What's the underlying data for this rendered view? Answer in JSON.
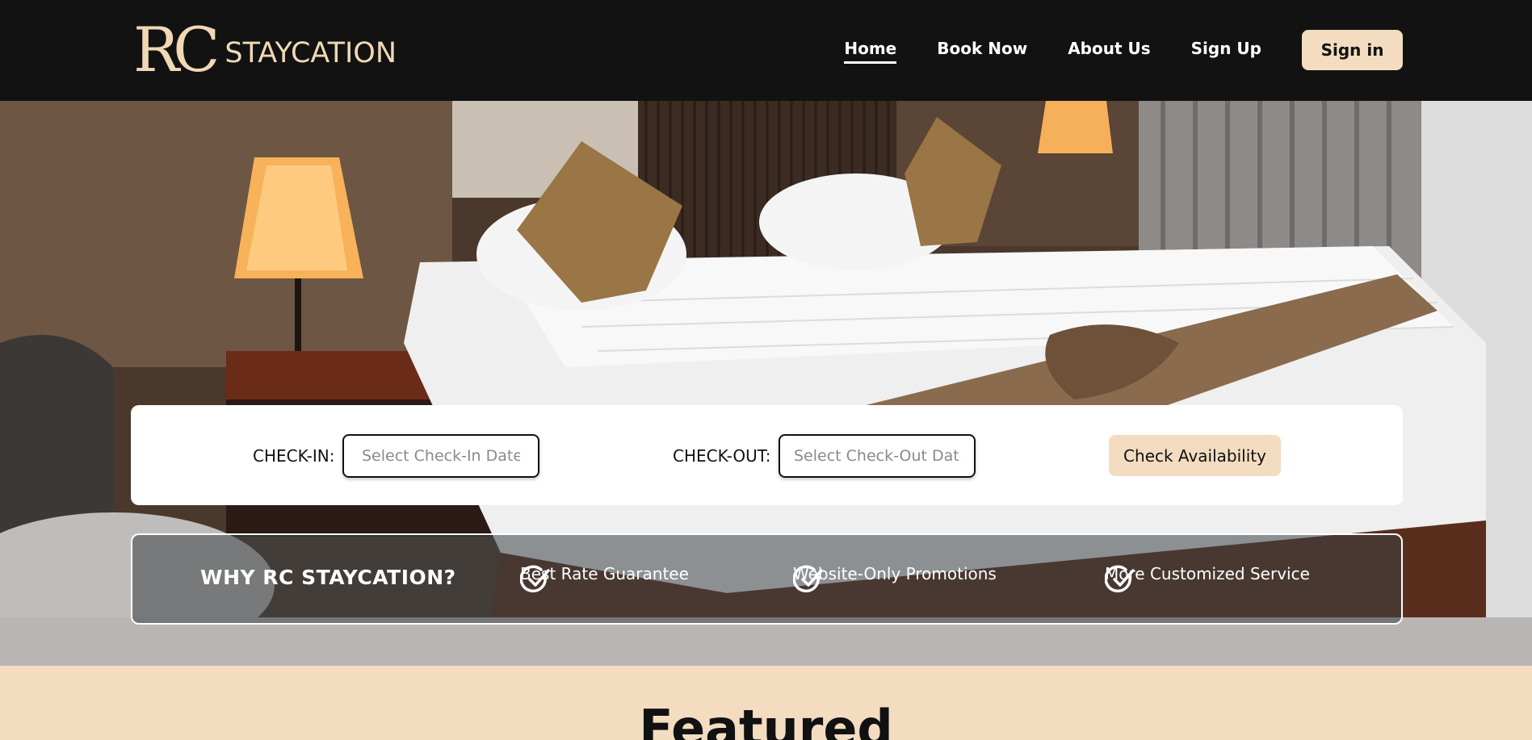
{
  "brand": {
    "logo_mark": "RC",
    "logo_text": "STAYCATION"
  },
  "nav": {
    "links": [
      {
        "label": "Home",
        "active": true
      },
      {
        "label": "Book Now",
        "active": false
      },
      {
        "label": "About Us",
        "active": false
      },
      {
        "label": "Sign Up",
        "active": false
      }
    ],
    "signin_label": "Sign in"
  },
  "search": {
    "checkin_label": "CHECK-IN:",
    "checkin_placeholder": "Select Check-In Date",
    "checkout_label": "CHECK-OUT:",
    "checkout_placeholder": "Select Check-Out Date",
    "button_label": "Check Availability"
  },
  "why": {
    "title": "WHY RC STAYCATION?",
    "items": [
      {
        "icon": "check-circle-icon",
        "label": "Best Rate Guarantee"
      },
      {
        "icon": "check-circle-icon",
        "label": "Website-Only Promotions"
      },
      {
        "icon": "check-circle-icon",
        "label": "More Customized Service"
      }
    ]
  },
  "featured": {
    "title": "Featured"
  },
  "colors": {
    "nav_bg": "#121212",
    "accent": "#f3dcc0",
    "logo": "#f0d8b5"
  }
}
